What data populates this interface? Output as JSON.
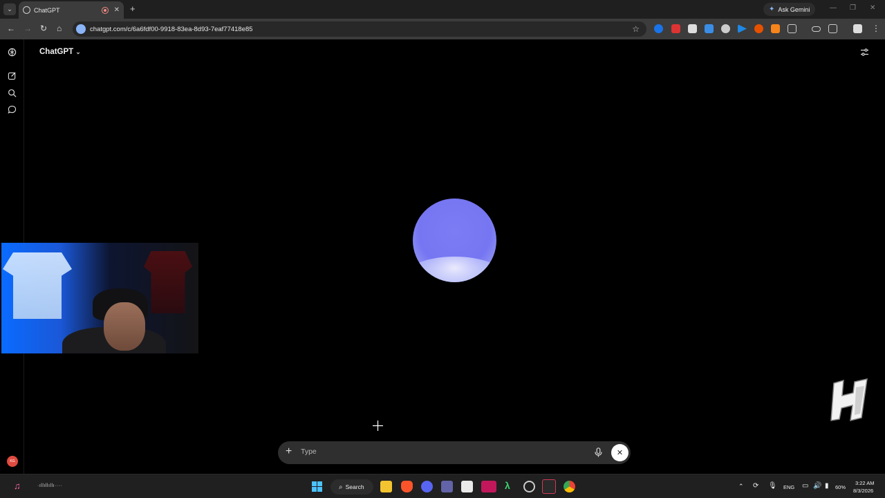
{
  "browser": {
    "tab_title": "ChatGPT",
    "url": "chatgpt.com/c/6a6fdf00-9918-83ea-8d93-7eaf77418e85",
    "ask_gemini_label": "Ask Gemini",
    "new_tab_symbol": "+",
    "tab_close_symbol": "✕"
  },
  "app": {
    "title": "ChatGPT",
    "chevron": "⌄"
  },
  "composer": {
    "placeholder": "Type",
    "add_symbol": "+",
    "end_symbol": "✕"
  },
  "sidebar": {
    "avatar_initials": "KG"
  },
  "taskbar": {
    "search_label": "Search",
    "language": "ENG",
    "battery": "60%",
    "time": "3:22 AM",
    "date": "8/3/2026"
  },
  "colors": {
    "orb_primary": "#7676f2",
    "orb_highlight": "#ffffff",
    "accent_link": "#8ab4f8",
    "avatar_bg": "#e04a3f"
  }
}
